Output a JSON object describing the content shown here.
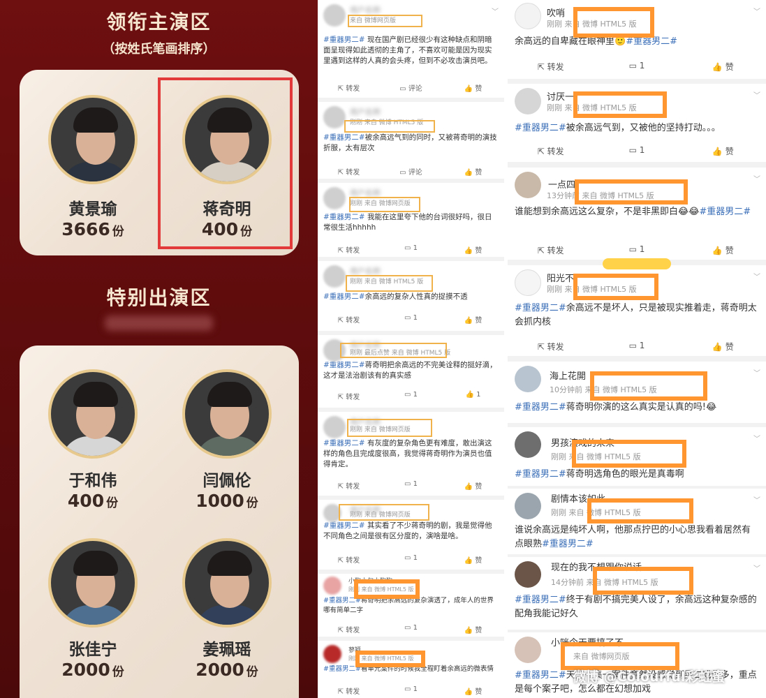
{
  "left": {
    "main_title": "领衔主演区",
    "main_sub": "（按姓氏笔画排序）",
    "special_title": "特别出演区",
    "actors_main": [
      {
        "name": "黄景瑜",
        "count": "3666",
        "unit": "份"
      },
      {
        "name": "蒋奇明",
        "count": "400",
        "unit": "份"
      }
    ],
    "actors_special": [
      {
        "name": "于和伟",
        "count": "400",
        "unit": "份"
      },
      {
        "name": "闫佩伦",
        "count": "1000",
        "unit": "份"
      },
      {
        "name": "张佳宁",
        "count": "2000",
        "unit": "份"
      },
      {
        "name": "姜珮瑶",
        "count": "2000",
        "unit": "份"
      }
    ]
  },
  "mid": {
    "actions": {
      "repost": "转发",
      "comment": "评论",
      "like": "赞"
    },
    "posts": [
      {
        "meta": "来自 微博网页版",
        "text_tag": "#重器男二#",
        "text": " 现在国产剧已经很少有这种缺点和阴暗面呈现得如此透彻的主角了，不喜欢可能是因为现实里遇到这样的人真的会头疼，但到不必攻击演员吧。",
        "comment": "评论",
        "likes": ""
      },
      {
        "meta": "刚刚 来自 微博 HTML5 版",
        "text_tag": "#重器男二#",
        "text": "被余高远气到的同时，又被蒋奇明的演技折服，太有层次",
        "comment": "评论",
        "likes": ""
      },
      {
        "meta": "刚刚 来自 微博网页版",
        "text_tag": "#重器男二#",
        "text": " 我能在这里夸下他的台词很好吗，很日常很生活hhhhh",
        "comment": "1",
        "likes": ""
      },
      {
        "meta": "刚刚 来自 微博 HTML5 版",
        "text_tag": "#重器男二#",
        "text": "余高远的复杂人性真的捉摸不透",
        "comment": "1",
        "likes": ""
      },
      {
        "meta": "刚刚 最后点赞  来自 微博 HTML5 版",
        "text_tag": "#重器男二#",
        "text": "蒋奇明把余高远的不完美诠释的挺好滴，这才是法治剧该有的真实感",
        "comment": "1",
        "likes": "1"
      },
      {
        "meta": "刚刚 来自 微博网页版",
        "text_tag": "#重器男二#",
        "text": " 有灰度的复杂角色更有难度，敢出演这样的角色且完成度很高，我觉得蒋奇明作为演员也值得肯定。",
        "comment": "1",
        "likes": ""
      },
      {
        "meta": "刚刚 来自 微博网页版",
        "text_tag": "#重器男二#",
        "text": " 其实看了不少蒋奇明的剧，我是觉得他不同角色之间是很有区分度的，演啥是啥。",
        "comment": "1",
        "likes": ""
      },
      {
        "name": "小狗小勾小狗狗",
        "meta": "刚刚 来自 微博 HTML5 版",
        "text_tag": "#重器男二#",
        "text": "蒋奇明把余高远的复杂演透了，成年人的世界哪有简单二字",
        "comment": "1",
        "likes": ""
      },
      {
        "name": "蓼颖",
        "meta": "刚刚 来自 微博 HTML5 版",
        "text_tag": "#重器男二#",
        "text": "看单元案件的时候我全程盯着余高远的微表情",
        "comment": "1",
        "likes": ""
      }
    ]
  },
  "right": {
    "actions": {
      "repost": "转发",
      "comment": "1",
      "like": "赞"
    },
    "posts": [
      {
        "name": "吹哨",
        "meta": "刚刚 来自 微博 HTML5 版",
        "text": "余高远的自卑藏在眼神里🙂",
        "tag": "#重器男二#"
      },
      {
        "name": "讨厌一",
        "meta": "刚刚 来自 微博 HTML5 版",
        "tag": "#重器男二#",
        "text": "被余高远气到，又被他的坚持打动。。。"
      },
      {
        "name": "一点四",
        "meta": "13分钟前 来自 微博 HTML5 版",
        "text": "谁能想到余高远这么复杂，不是非黑即白😂😂",
        "tag": "#重器男二#"
      },
      {
        "name": "阳光不",
        "meta": "刚刚 来自 微博 HTML5 版",
        "tag": "#重器男二#",
        "text": "余高远不是坏人，只是被现实推着走，蒋奇明太会抓内核"
      },
      {
        "name": "海上花開",
        "meta": "10分钟前 来自 微博 HTML5 版",
        "tag": "#重器男二#",
        "text": "蒋奇明你演的这么真实是认真的吗!😂"
      },
      {
        "name": "男孩演戏的未来",
        "meta": "刚刚 来自 微博 HTML5 版",
        "tag": "#重器男二#",
        "text": "蒋奇明选角色的眼光是真毒啊"
      },
      {
        "name": "剧情本该如此",
        "meta": "刚刚 来自 微博 HTML5 版",
        "text": "谁说余高远是纯坏人啊，他那点拧巴的小心思我看着居然有点眼熟",
        "tag": "#重器男二#"
      },
      {
        "name": "现在的我不想跟你说话",
        "meta": "14分钟前 来自 微博 HTML5 版",
        "tag": "#重器男二#",
        "text": "终于有剧不搞完美人设了，余高远这种复杂感的配角我能记好久"
      },
      {
        "name": "小咪今天要搞了不",
        "meta": "来自 微博网页版",
        "tag": "#重器男二#",
        "text": "天天一集一案件竟然没感觉到男二戏份多，重点是每个案子吧，怎么都在幻想加戏"
      }
    ],
    "watermark": "微博 @Colourful彩虹蜜"
  }
}
